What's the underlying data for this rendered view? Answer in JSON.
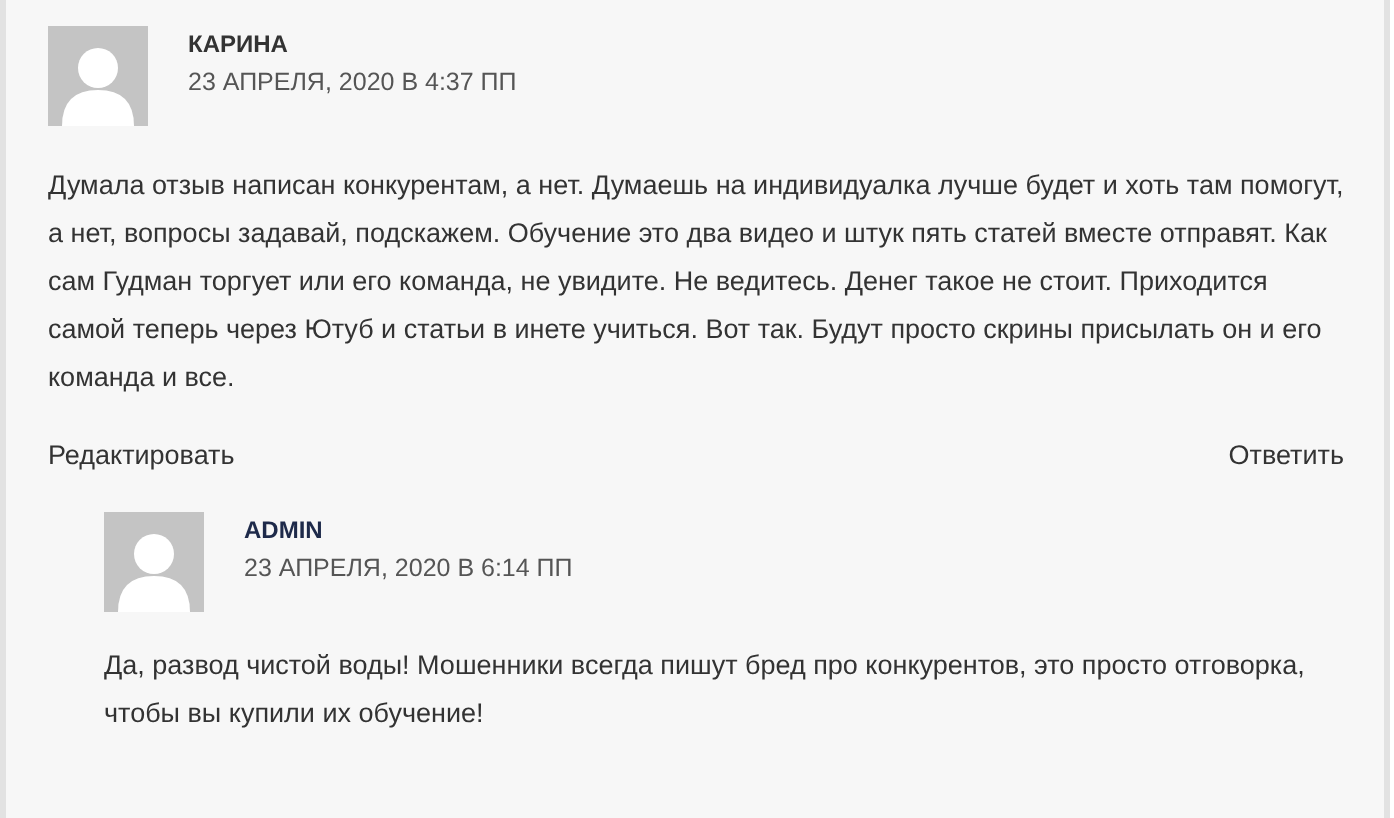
{
  "comment": {
    "author": "КАРИНА",
    "date": "23 АПРЕЛЯ, 2020 В 4:37 ПП",
    "text": "Думала отзыв написан конкурентам, а нет. Думаешь на индивидуалка лучше будет и хоть там помогут, а нет, вопросы задавай, подскажем. Обучение это два видео и штук пять статей вместе отправят. Как сам Гудман торгует или его команда, не увидите. Не ведитесь. Денег такое не стоит. Приходится самой теперь через Ютуб и статьи в инете учиться. Вот так. Будут просто скрины присылать он и его команда и все.",
    "edit_link": "Редактировать",
    "reply_link": "Ответить"
  },
  "reply": {
    "author": "ADMIN",
    "date": "23 АПРЕЛЯ, 2020 В 6:14 ПП",
    "text": "Да, развод чистой воды! Мошенники всегда пишут бред про конкурентов, это просто отговорка, чтобы вы купили их обучение!"
  }
}
